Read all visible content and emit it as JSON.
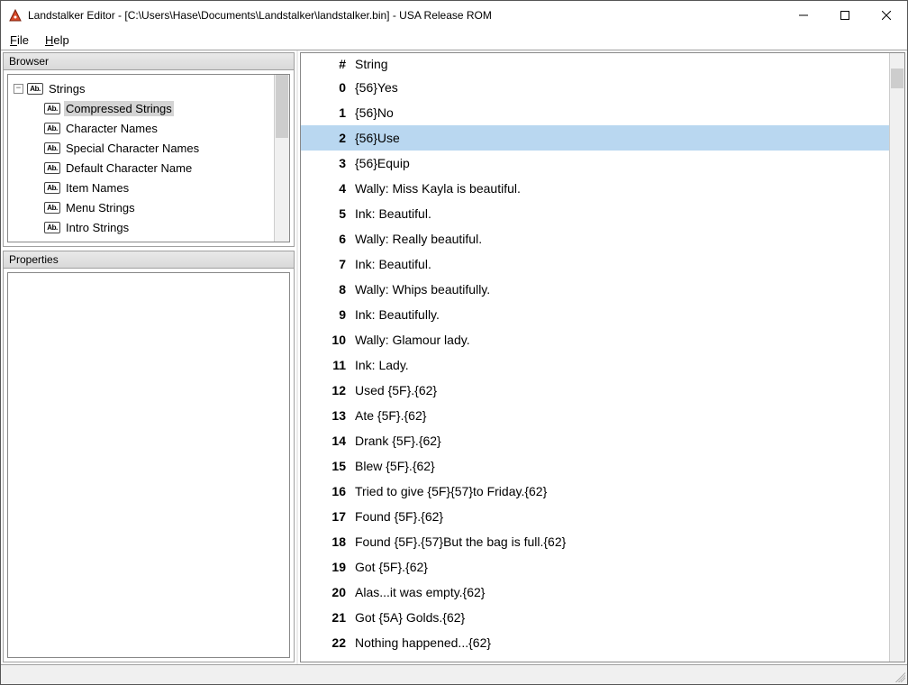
{
  "title": "Landstalker Editor - [C:\\Users\\Hase\\Documents\\Landstalker\\landstalker.bin] - USA Release ROM",
  "menu": {
    "file": "File",
    "help": "Help"
  },
  "panels": {
    "browser": "Browser",
    "properties": "Properties"
  },
  "tree": {
    "root": "Strings",
    "children": [
      "Compressed Strings",
      "Character Names",
      "Special Character Names",
      "Default Character Name",
      "Item Names",
      "Menu Strings",
      "Intro Strings"
    ],
    "selected_index": 0
  },
  "list": {
    "header_num": "#",
    "header_str": "String",
    "selected_index": 2,
    "rows": [
      {
        "n": 0,
        "s": "{56}Yes"
      },
      {
        "n": 1,
        "s": "{56}No"
      },
      {
        "n": 2,
        "s": "{56}Use"
      },
      {
        "n": 3,
        "s": "{56}Equip"
      },
      {
        "n": 4,
        "s": "Wally: Miss Kayla is beautiful."
      },
      {
        "n": 5,
        "s": "Ink: Beautiful."
      },
      {
        "n": 6,
        "s": "Wally: Really beautiful."
      },
      {
        "n": 7,
        "s": "Ink: Beautiful."
      },
      {
        "n": 8,
        "s": "Wally: Whips beautifully."
      },
      {
        "n": 9,
        "s": "Ink: Beautifully."
      },
      {
        "n": 10,
        "s": "Wally: Glamour lady."
      },
      {
        "n": 11,
        "s": "Ink: Lady."
      },
      {
        "n": 12,
        "s": "Used {5F}.{62}"
      },
      {
        "n": 13,
        "s": "Ate {5F}.{62}"
      },
      {
        "n": 14,
        "s": "Drank {5F}.{62}"
      },
      {
        "n": 15,
        "s": "Blew {5F}.{62}"
      },
      {
        "n": 16,
        "s": "Tried to give {5F}{57}to Friday.{62}"
      },
      {
        "n": 17,
        "s": "Found {5F}.{62}"
      },
      {
        "n": 18,
        "s": "Found {5F}.{57}But the bag is full.{62}"
      },
      {
        "n": 19,
        "s": "Got {5F}.{62}"
      },
      {
        "n": 20,
        "s": "Alas...it was empty.{62}"
      },
      {
        "n": 21,
        "s": "Got {5A} Golds.{62}"
      },
      {
        "n": 22,
        "s": "Nothing happened...{62}"
      }
    ]
  }
}
